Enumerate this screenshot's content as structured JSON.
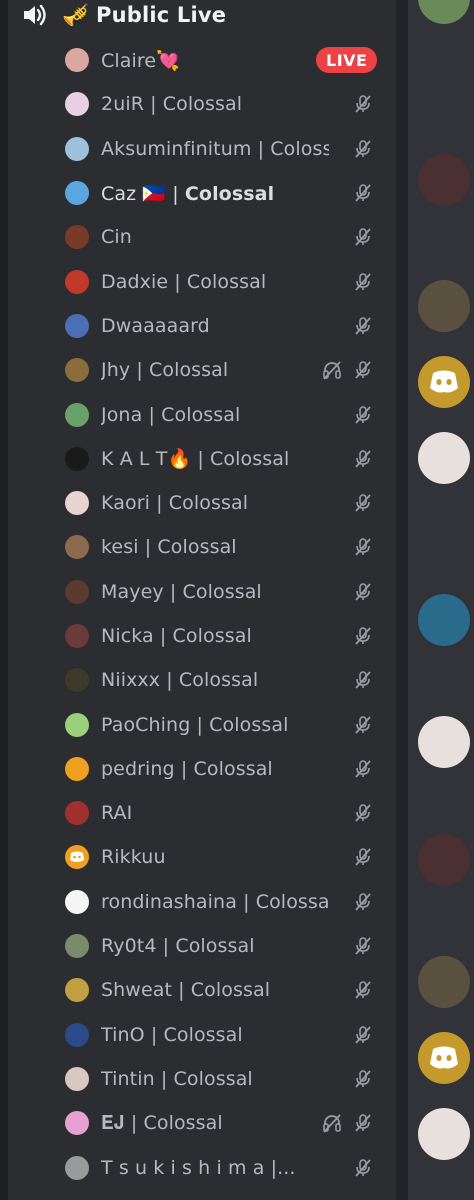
{
  "channel": {
    "title": "Public Live",
    "channel_icon": "speaker-icon",
    "emoji_icon": "trumpet-icon"
  },
  "live_label": "LIVE",
  "colors": {
    "live_red": "#ed4245",
    "panel_bg": "#2b2d31",
    "text_muted": "#b5bac1",
    "discord_gold": "#c49a2c"
  },
  "members": [
    {
      "name": "Claire",
      "suffix": "💘",
      "status": "live",
      "avatar": "#d9a7a0"
    },
    {
      "name": "2uiR",
      "suffix": " | Colossal",
      "status": "muted",
      "avatar": "#e8d0e2"
    },
    {
      "name": "Aksuminfinitum",
      "suffix": " | Colossal",
      "status": "muted",
      "avatar": "#9cc1d8"
    },
    {
      "name": "Caz 🇵🇭 | ",
      "suffix": "Colossal",
      "status": "muted",
      "avatar": "#5aa7e0",
      "bold_suffix": true
    },
    {
      "name": "Cin",
      "suffix": "",
      "status": "muted",
      "avatar": "#7a3a2a"
    },
    {
      "name": "Dadxie",
      "suffix": " | Colossal",
      "status": "muted",
      "avatar": "#c0392b"
    },
    {
      "name": "Dwaaaaard",
      "suffix": "",
      "status": "muted",
      "avatar": "#4a6fb5"
    },
    {
      "name": "Jhy",
      "suffix": " | Colossal",
      "status": "muted-deafened",
      "avatar": "#8a6d3b"
    },
    {
      "name": "Jona",
      "suffix": " | Colossal",
      "status": "muted",
      "avatar": "#6aa06a"
    },
    {
      "name": "K A L T🔥",
      "suffix": " | Colossal",
      "status": "muted",
      "avatar": "#1a1a1a"
    },
    {
      "name": "Kaori",
      "suffix": " | Colossal",
      "status": "muted",
      "avatar": "#e8d5d0"
    },
    {
      "name": "kesi",
      "suffix": " | Colossal",
      "status": "muted",
      "avatar": "#8c6a4e"
    },
    {
      "name": "Mayey",
      "suffix": " | Colossal",
      "status": "muted",
      "avatar": "#5c3a30"
    },
    {
      "name": "Nicka",
      "suffix": " | Colossal",
      "status": "muted",
      "avatar": "#6b3a3a"
    },
    {
      "name": "Niixxx",
      "suffix": " | Colossal",
      "status": "muted",
      "avatar": "#3e3a2a"
    },
    {
      "name": "PaoChing",
      "suffix": " | Colossal",
      "status": "muted",
      "avatar": "#9ad07a"
    },
    {
      "name": "pedring",
      "suffix": " | Colossal",
      "status": "muted",
      "avatar": "#f0a020"
    },
    {
      "name": "RAI",
      "suffix": "",
      "status": "muted",
      "avatar": "#a03030"
    },
    {
      "name": "Rikkuu",
      "suffix": "",
      "status": "muted",
      "avatar": "#f0a020"
    },
    {
      "name": "rondinashaina",
      "suffix": " | Colossal",
      "status": "muted",
      "avatar": "#f5f5f5"
    },
    {
      "name": "Ry0t4",
      "suffix": " | Colossal",
      "status": "muted",
      "avatar": "#7a8a6a"
    },
    {
      "name": "Shweat",
      "suffix": " | Colossal",
      "status": "muted",
      "avatar": "#c0a040"
    },
    {
      "name": "TinO",
      "suffix": " | Colossal",
      "status": "muted",
      "avatar": "#2a4a8a"
    },
    {
      "name": "Tintin",
      "suffix": " | Colossal",
      "status": "muted",
      "avatar": "#d8c8c0"
    },
    {
      "name": "𝐄𝐉",
      "suffix": " | Colossal",
      "status": "muted-deafened",
      "avatar": "#e8a0d0"
    },
    {
      "name": "T s u k i s h i m a |...",
      "suffix": "",
      "status": "muted",
      "avatar": "#9a9a9a"
    }
  ],
  "right_avatars": [
    {
      "kind": "photo",
      "color": "#6b8a5a"
    },
    {
      "kind": "photo",
      "color": "#4a3030"
    },
    {
      "kind": "photo",
      "color": "#5a5040"
    },
    {
      "kind": "discord",
      "color": "#c49a2c"
    },
    {
      "kind": "photo",
      "color": "#e8e0dc"
    },
    {
      "kind": "photo",
      "color": "#2a6a8a"
    },
    {
      "kind": "photo",
      "color": "#e8e0dc"
    },
    {
      "kind": "photo",
      "color": "#4a3030"
    },
    {
      "kind": "photo",
      "color": "#5a5040"
    },
    {
      "kind": "discord",
      "color": "#c49a2c"
    },
    {
      "kind": "photo",
      "color": "#e8e0dc"
    }
  ]
}
